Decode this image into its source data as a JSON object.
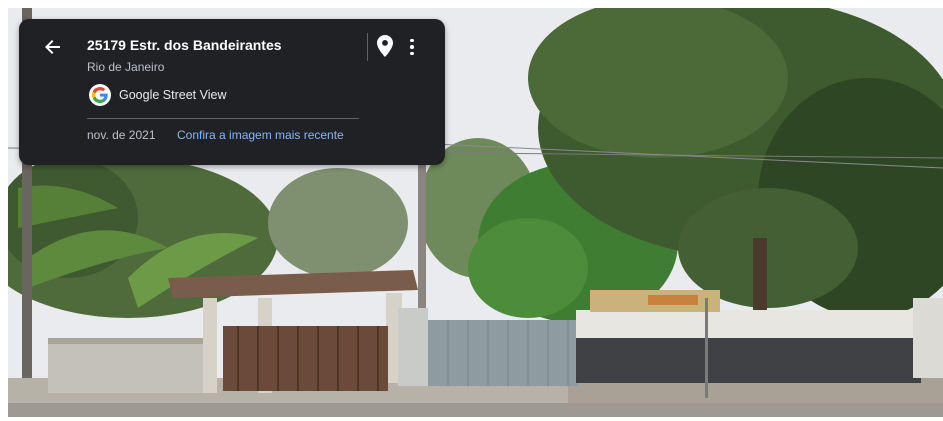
{
  "place": {
    "title": "25179 Estr. dos Bandeirantes",
    "subtitle": "Rio de Janeiro"
  },
  "source": {
    "label": "Google Street View",
    "logo_letter": "G"
  },
  "capture": {
    "date": "nov. de 2021",
    "recent_link": "Confira a imagem mais recente"
  },
  "icons": {
    "back": "arrow-left-icon",
    "location": "map-pin-icon",
    "menu": "more-vert-icon"
  },
  "colors": {
    "panel_bg": "#202124",
    "link": "#8ab4f8",
    "sky": "#e9ebee"
  }
}
